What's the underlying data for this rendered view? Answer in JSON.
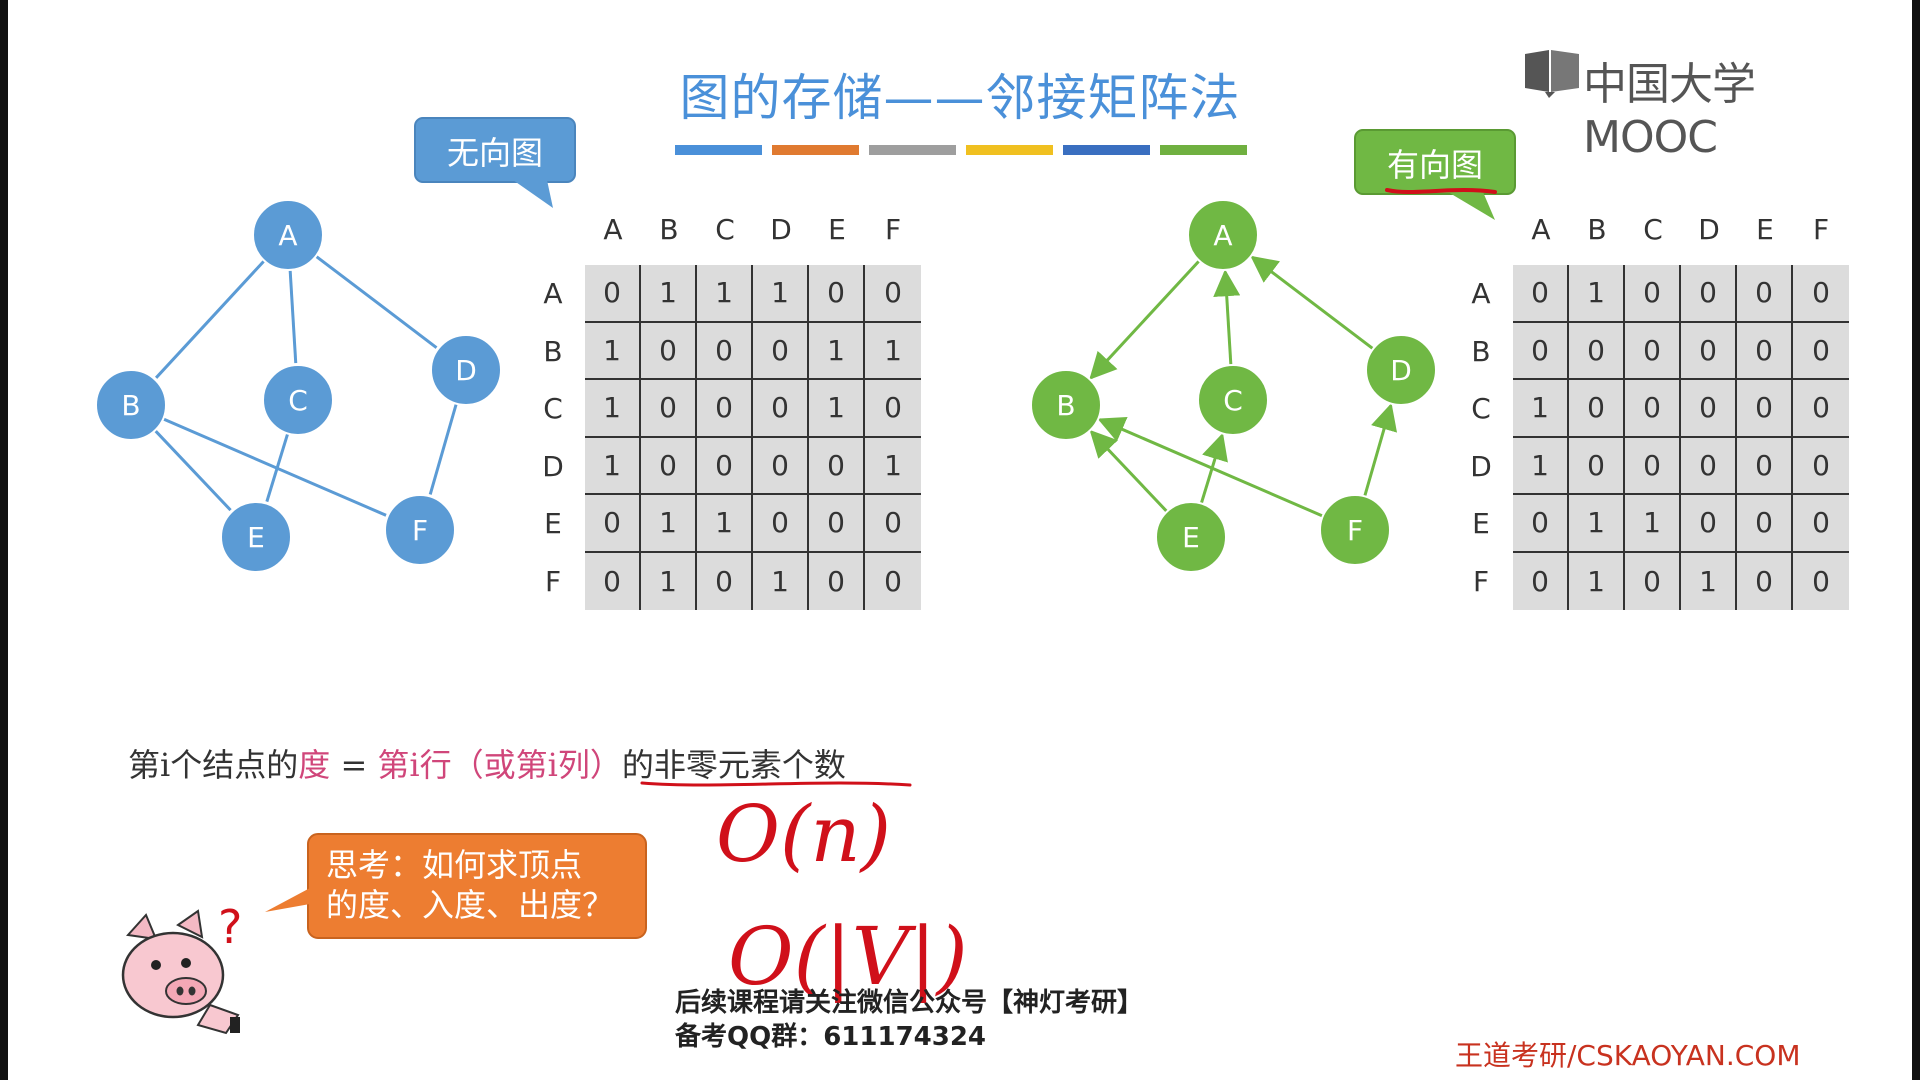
{
  "title": "图的存储——邻接矩阵法",
  "title_bar_colors": [
    "#4a90d9",
    "#e07a30",
    "#9e9e9e",
    "#f0c020",
    "#3a6fc0",
    "#70b040"
  ],
  "logo": {
    "text": "中国大学MOOC",
    "icon": "mooc-book-icon"
  },
  "undirected": {
    "callout": "无向图",
    "color": "#5b9bd5",
    "nodes": [
      "A",
      "B",
      "C",
      "D",
      "E",
      "F"
    ],
    "edges": [
      [
        "A",
        "B"
      ],
      [
        "A",
        "C"
      ],
      [
        "A",
        "D"
      ],
      [
        "B",
        "E"
      ],
      [
        "B",
        "F"
      ],
      [
        "C",
        "E"
      ],
      [
        "D",
        "F"
      ]
    ],
    "matrix": {
      "col_headers": [
        "A",
        "B",
        "C",
        "D",
        "E",
        "F"
      ],
      "row_headers": [
        "A",
        "B",
        "C",
        "D",
        "E",
        "F"
      ],
      "rows": [
        [
          "0",
          "1",
          "1",
          "1",
          "0",
          "0"
        ],
        [
          "1",
          "0",
          "0",
          "0",
          "1",
          "1"
        ],
        [
          "1",
          "0",
          "0",
          "0",
          "1",
          "0"
        ],
        [
          "1",
          "0",
          "0",
          "0",
          "0",
          "1"
        ],
        [
          "0",
          "1",
          "1",
          "0",
          "0",
          "0"
        ],
        [
          "0",
          "1",
          "0",
          "1",
          "0",
          "0"
        ]
      ]
    }
  },
  "directed": {
    "callout": "有向图",
    "color": "#70b844",
    "nodes": [
      "A",
      "B",
      "C",
      "D",
      "E",
      "F"
    ],
    "arcs": [
      [
        "A",
        "B"
      ],
      [
        "C",
        "A"
      ],
      [
        "D",
        "A"
      ],
      [
        "E",
        "B"
      ],
      [
        "E",
        "C"
      ],
      [
        "F",
        "B"
      ],
      [
        "F",
        "D"
      ]
    ],
    "matrix": {
      "col_headers": [
        "A",
        "B",
        "C",
        "D",
        "E",
        "F"
      ],
      "row_headers": [
        "A",
        "B",
        "C",
        "D",
        "E",
        "F"
      ],
      "rows": [
        [
          "0",
          "1",
          "0",
          "0",
          "0",
          "0"
        ],
        [
          "0",
          "0",
          "0",
          "0",
          "0",
          "0"
        ],
        [
          "1",
          "0",
          "0",
          "0",
          "0",
          "0"
        ],
        [
          "1",
          "0",
          "0",
          "0",
          "0",
          "0"
        ],
        [
          "0",
          "1",
          "1",
          "0",
          "0",
          "0"
        ],
        [
          "0",
          "1",
          "0",
          "1",
          "0",
          "0"
        ]
      ]
    }
  },
  "formula": {
    "p1": "第i个结点的",
    "p2": "度",
    "p3": " = ",
    "p4": "第i行（或第i列）",
    "p5": "的非零元素个数"
  },
  "think_bubble": {
    "line1": "思考：如何求顶点",
    "line2": "的度、入度、出度？"
  },
  "handwriting": {
    "line1": "O(n)",
    "line2": "O(|V|)"
  },
  "footer": {
    "line1": "后续课程请关注微信公众号【神灯考研】",
    "line2": "备考QQ群：611174324"
  },
  "site": "王道考研/CSKAOYAN.COM"
}
